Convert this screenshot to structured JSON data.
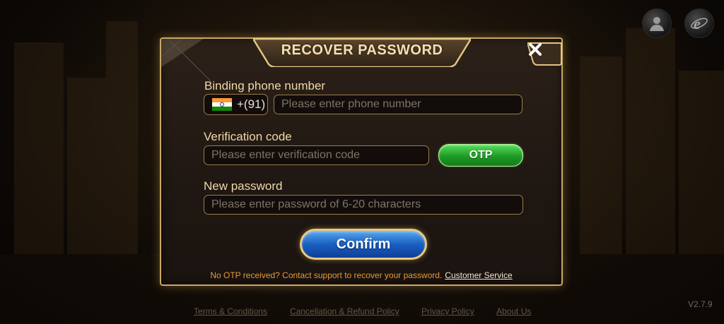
{
  "dialog": {
    "title": "RECOVER PASSWORD",
    "close_icon": "close-icon",
    "phone": {
      "label": "Binding phone number",
      "country_flag": "india-flag-icon",
      "country_code": "+(91)",
      "placeholder": "Please enter phone number",
      "value": ""
    },
    "verification": {
      "label": "Verification code",
      "placeholder": "Please enter verification code",
      "value": "",
      "otp_label": "OTP"
    },
    "new_password": {
      "label": "New password",
      "placeholder": "Please enter password of 6-20 characters",
      "value": ""
    },
    "confirm_label": "Confirm",
    "help_text": "No OTP received? Contact support to recover your password.",
    "help_link": "Customer Service"
  },
  "top_icons": [
    "user-icon",
    "browser-icon"
  ],
  "footer": {
    "links": [
      "Terms & Conditions",
      "Cancellation & Refund Policy",
      "Privacy Policy",
      "About Us"
    ],
    "version": "V2.7.9"
  },
  "colors": {
    "accent_gold": "#c9a765",
    "otp_green": "#1e9a25",
    "confirm_blue": "#1a5fc2",
    "help_orange": "#e69a3a"
  }
}
